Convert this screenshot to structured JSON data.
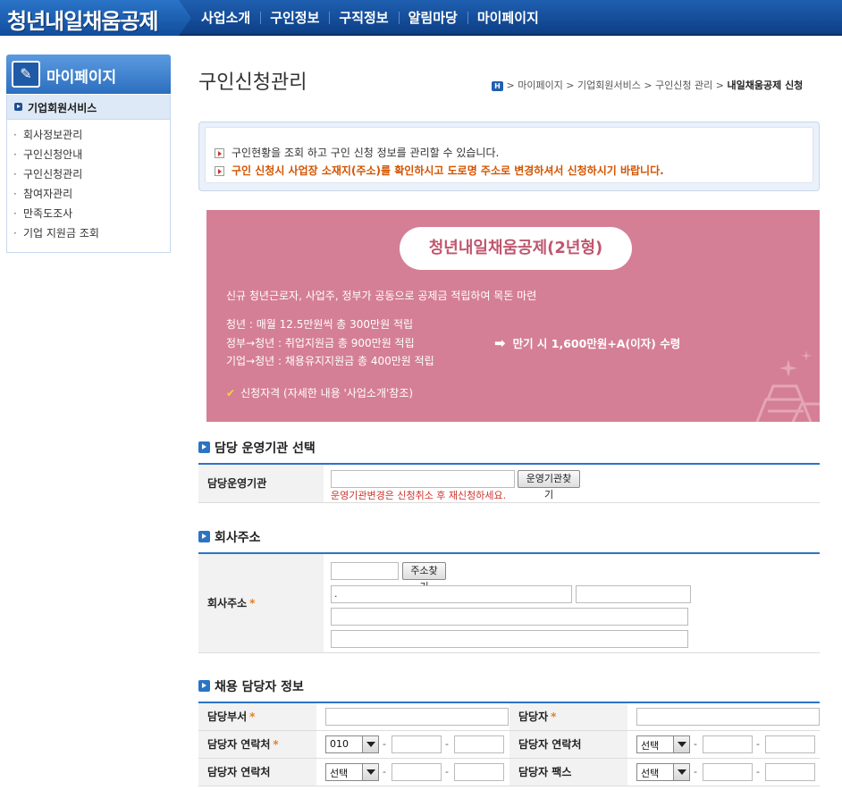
{
  "header": {
    "logo": "청년내일채움공제",
    "menu": [
      "사업소개",
      "구인정보",
      "구직정보",
      "알림마당",
      "마이페이지"
    ]
  },
  "sidebar": {
    "title": "마이페이지",
    "section": "기업회원서비스",
    "items": [
      "회사정보관리",
      "구인신청안내",
      "구인신청관리",
      "참여자관리",
      "만족도조사",
      "기업 지원금 조회"
    ]
  },
  "page": {
    "title": "구인신청관리",
    "breadcrumb": {
      "home_icon": "H",
      "c1": "> 마이페이지 > 기업회원서비스 > 구인신청 관리 >",
      "current": "내일채움공제 신청"
    }
  },
  "notice": {
    "line1": "구인현황을 조회 하고 구인 신청 정보를 관리할 수 있습니다.",
    "line2": "구인 신청시 사업장 소재지(주소)를 확인하시고 도로명 주소로 변경하셔서 신청하시기 바랍니다."
  },
  "promo": {
    "title": "청년내일채움공제(2년형)",
    "desc": "신규 청년근로자, 사업주, 정부가 공동으로 공제금 적립하여 목돈 마련",
    "rows": [
      "청년 : 매월 12.5만원씩 총 300만원 적립",
      "정부→청년 : 취업지원금 총 900만원 적립",
      "기업→청년 : 채용유지지원금 총 400만원 적립"
    ],
    "result": "만기 시 1,600만원+A(이자) 수령",
    "eligibility": "신청자격 (자세한 내용 '사업소개'참조)"
  },
  "section_agency": {
    "title": "담당 운영기관 선택",
    "label": "담당운영기관",
    "input_value": "",
    "button": "운영기관찾기",
    "warning": "운영기관변경은 신청취소 후 재신청하세요."
  },
  "section_address": {
    "title": "회사주소",
    "label": "회사주소",
    "required": "*",
    "zip_value": "",
    "button": "주소찾기",
    "addr1_value": ".",
    "addr2_value": "",
    "addr3_value": "",
    "addr4_value": ""
  },
  "section_contact": {
    "title": "채용 담당자 정보",
    "dept_label": "담당부서",
    "person_label": "담당자",
    "phone_label": "담당자 연락처",
    "phone2_label": "담당자 연락처",
    "phone3_label": "담당자 연락처",
    "fax_label": "담당자 팩스",
    "required": "*",
    "sel_010": "010",
    "sel_default": "선택",
    "dash": "-"
  },
  "colors": {
    "nav": "#0d3f86",
    "accent": "#2b74c4",
    "promo_bg": "#d47f95",
    "warning": "#d35400",
    "required": "#e67e22"
  }
}
